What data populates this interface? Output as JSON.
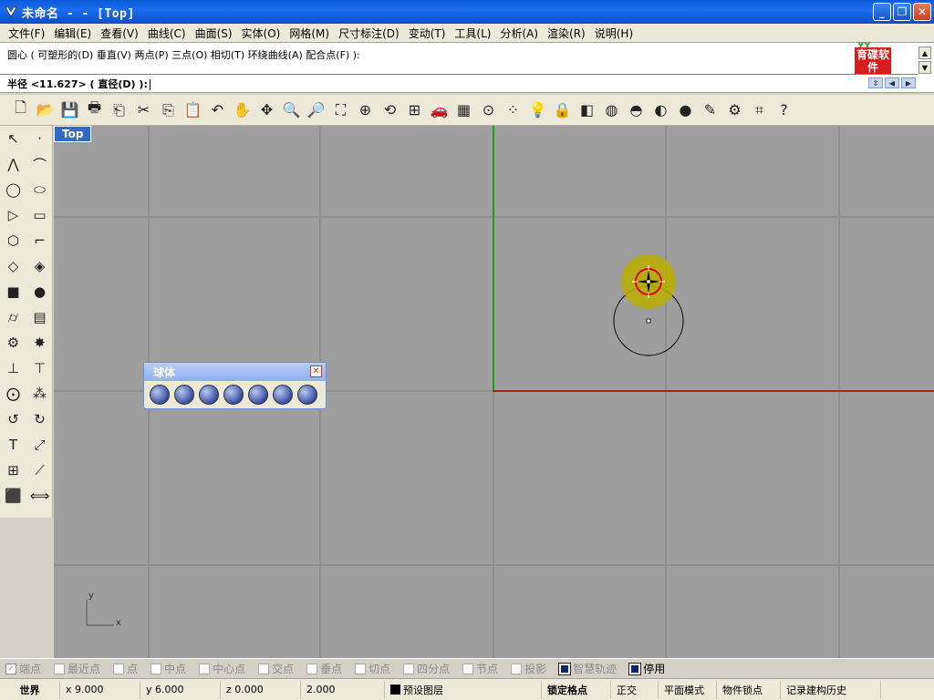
{
  "window": {
    "title": "未命名 -  - [Top]",
    "controls": {
      "minimize": "_",
      "maximize": "❐",
      "close": "✕"
    }
  },
  "menu": [
    "文件(F)",
    "编辑(E)",
    "查看(V)",
    "曲线(C)",
    "曲面(S)",
    "实体(O)",
    "网格(M)",
    "尺寸标注(D)",
    "变动(T)",
    "工具(L)",
    "分析(A)",
    "渲染(R)",
    "说明(H)"
  ],
  "command": {
    "history": "圆心 ( 可塑形的(D)  垂直(V)  两点(P)  三点(O)  相切(T)  环绕曲线(A)  配合点(F) ):",
    "prompt": "半径 <11.627> ( 直径(D) ):"
  },
  "logo": {
    "text": "育碟软件"
  },
  "toolbar_icons": [
    {
      "name": "new-icon",
      "glyph": "🗋"
    },
    {
      "name": "open-icon",
      "glyph": "📂"
    },
    {
      "name": "save-icon",
      "glyph": "💾"
    },
    {
      "name": "print-icon",
      "glyph": "🖶"
    },
    {
      "name": "import-icon",
      "glyph": "⎗"
    },
    {
      "name": "cut-icon",
      "glyph": "✂"
    },
    {
      "name": "copy-icon",
      "glyph": "⎘"
    },
    {
      "name": "paste-icon",
      "glyph": "📋"
    },
    {
      "name": "undo-icon",
      "glyph": "↶"
    },
    {
      "name": "pan-icon",
      "glyph": "✋"
    },
    {
      "name": "rotate-view-icon",
      "glyph": "✥"
    },
    {
      "name": "zoom-icon",
      "glyph": "🔍"
    },
    {
      "name": "zoom-window-icon",
      "glyph": "🔎"
    },
    {
      "name": "zoom-extents-icon",
      "glyph": "⛶"
    },
    {
      "name": "zoom-selected-icon",
      "glyph": "⊕"
    },
    {
      "name": "undo-view-icon",
      "glyph": "⟲"
    },
    {
      "name": "four-viewports-icon",
      "glyph": "⊞"
    },
    {
      "name": "car-icon",
      "glyph": "🚗"
    },
    {
      "name": "grid-icon",
      "glyph": "▦"
    },
    {
      "name": "snap-icon",
      "glyph": "⊙"
    },
    {
      "name": "points-icon",
      "glyph": "⁘"
    },
    {
      "name": "light-icon",
      "glyph": "💡"
    },
    {
      "name": "lock-icon",
      "glyph": "🔒"
    },
    {
      "name": "layer-icon",
      "glyph": "◧"
    },
    {
      "name": "color-wheel-icon",
      "glyph": "◍"
    },
    {
      "name": "wireframe-sphere-icon",
      "glyph": "◓"
    },
    {
      "name": "shaded-icon",
      "glyph": "◐"
    },
    {
      "name": "render-sphere-icon",
      "glyph": "●"
    },
    {
      "name": "brush-icon",
      "glyph": "✎"
    },
    {
      "name": "options-icon",
      "glyph": "⚙"
    },
    {
      "name": "osnap-icon",
      "glyph": "⌗"
    },
    {
      "name": "help-icon",
      "glyph": "?"
    }
  ],
  "left_toolbar_icons": [
    {
      "name": "select-icon",
      "glyph": "↖"
    },
    {
      "name": "point-icon",
      "glyph": "·"
    },
    {
      "name": "polyline-icon",
      "glyph": "⋀"
    },
    {
      "name": "curve-icon",
      "glyph": "⌒"
    },
    {
      "name": "circle-icon",
      "glyph": "◯"
    },
    {
      "name": "ellipse-icon",
      "glyph": "⬭"
    },
    {
      "name": "arc-icon",
      "glyph": "▷"
    },
    {
      "name": "rectangle-icon",
      "glyph": "▭"
    },
    {
      "name": "polygon-icon",
      "glyph": "⬡"
    },
    {
      "name": "fillet-icon",
      "glyph": "⌐"
    },
    {
      "name": "surface-icon",
      "glyph": "◇"
    },
    {
      "name": "surface-edit-icon",
      "glyph": "◈"
    },
    {
      "name": "box-icon",
      "glyph": "■"
    },
    {
      "name": "sphere-icon",
      "glyph": "●"
    },
    {
      "name": "cylinder-icon",
      "glyph": "⌭"
    },
    {
      "name": "mesh-icon",
      "glyph": "▤"
    },
    {
      "name": "gear-tool-icon",
      "glyph": "⚙"
    },
    {
      "name": "explode-icon",
      "glyph": "✸"
    },
    {
      "name": "trim-icon",
      "glyph": "⊥"
    },
    {
      "name": "split-icon",
      "glyph": "⊤"
    },
    {
      "name": "boolean-icon",
      "glyph": "⨀"
    },
    {
      "name": "group-icon",
      "glyph": "⁂"
    },
    {
      "name": "analyze-icon",
      "glyph": "↺"
    },
    {
      "name": "curve-analyze-icon",
      "glyph": "↻"
    },
    {
      "name": "text-icon",
      "glyph": "T"
    },
    {
      "name": "scale-icon",
      "glyph": "⤢"
    },
    {
      "name": "array-icon",
      "glyph": "⊞"
    },
    {
      "name": "transform-icon",
      "glyph": "⟋"
    },
    {
      "name": "solid-icon",
      "glyph": "⬛"
    },
    {
      "name": "dimension-icon",
      "glyph": "⟺"
    }
  ],
  "viewport": {
    "label": "Top",
    "axis_x": "x",
    "axis_y": "y"
  },
  "float_panel": {
    "title": "球体",
    "buttons": 7
  },
  "osnaps": [
    {
      "label": "端点",
      "checked": true
    },
    {
      "label": "最近点",
      "checked": false
    },
    {
      "label": "点",
      "checked": false
    },
    {
      "label": "中点",
      "checked": false
    },
    {
      "label": "中心点",
      "checked": false
    },
    {
      "label": "交点",
      "checked": false
    },
    {
      "label": "垂点",
      "checked": false
    },
    {
      "label": "切点",
      "checked": false
    },
    {
      "label": "四分点",
      "checked": false
    },
    {
      "label": "节点",
      "checked": false
    },
    {
      "label": "投影",
      "checked": false
    },
    {
      "label": "智慧轨迹",
      "checked": false,
      "blue": true
    },
    {
      "label": "停用",
      "checked": false,
      "blue": true,
      "dark": true
    }
  ],
  "status": {
    "cplane": "世界",
    "x": "x 9.000",
    "y": "y 6.000",
    "z": "z 0.000",
    "distance": "2.000",
    "layer": "预设图层",
    "snap": "锁定格点",
    "ortho": "正交",
    "planar": "平面模式",
    "osnap": "物件锁点",
    "history": "记录建构历史"
  }
}
